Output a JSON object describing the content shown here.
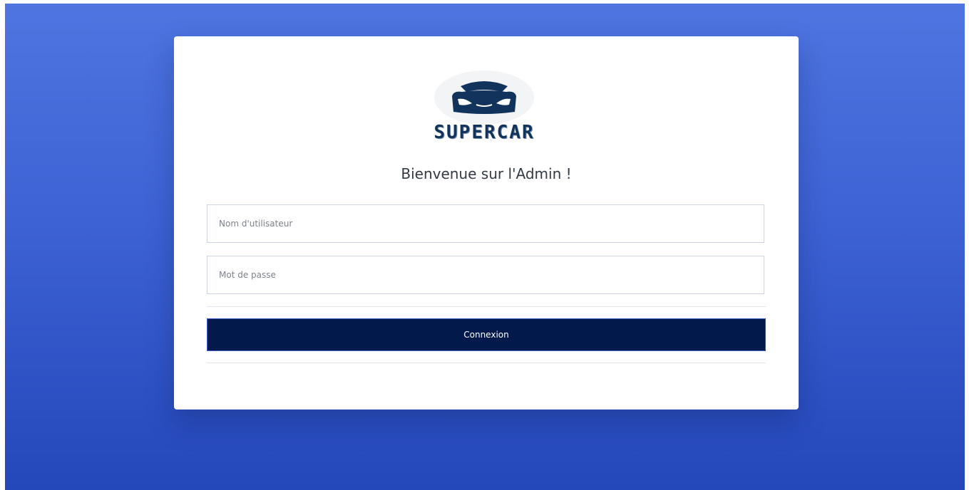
{
  "brand": {
    "logo_text": "SUPERCAR",
    "primary_color": "#12335c"
  },
  "login": {
    "welcome_title": "Bienvenue sur l'Admin !",
    "username_placeholder": "Nom d'utilisateur",
    "username_value": "",
    "password_placeholder": "Mot de passe",
    "password_value": "",
    "submit_label": "Connexion"
  },
  "colors": {
    "background_top": "#4e75e0",
    "background_bottom": "#2447ba",
    "button_background": "#021a4b",
    "card_background": "#ffffff"
  }
}
